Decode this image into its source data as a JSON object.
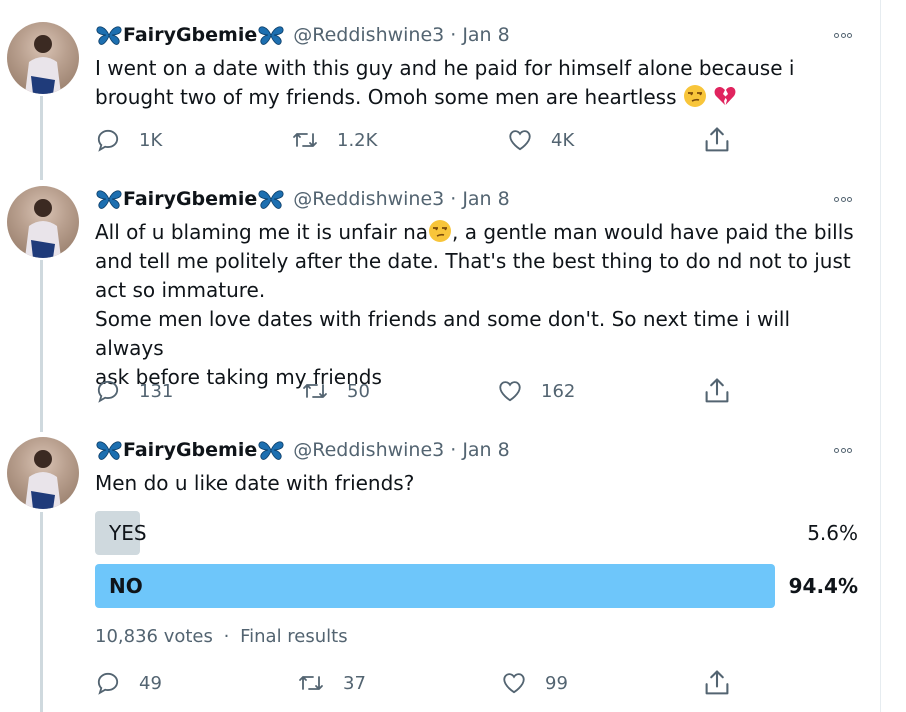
{
  "tweets": [
    {
      "name": "FairyGbemie",
      "handle": "@Reddishwine3",
      "separator": "·",
      "date": "Jan 8",
      "text_lines": [
        "I went on a date with this guy and he paid for himself alone because i",
        "brought two of my friends. Omoh some men are heartless"
      ],
      "emojis": [
        "unamused-face",
        "broken-heart"
      ],
      "replies": "1K",
      "retweets": "1.2K",
      "likes": "4K"
    },
    {
      "name": "FairyGbemie",
      "handle": "@Reddishwine3",
      "separator": "·",
      "date": "Jan 8",
      "text_lines": [
        "All of u blaming me it is unfair na",
        ", a gentle man would have paid the bills",
        "and tell me politely after the date. That's the best thing to do nd not to just",
        "act so immature.",
        "Some men love dates with friends and some don't. So next time i will always",
        "ask before taking my friends"
      ],
      "emojis": [
        "unamused-face"
      ],
      "replies": "131",
      "retweets": "50",
      "likes": "162"
    },
    {
      "name": "FairyGbemie",
      "handle": "@Reddishwine3",
      "separator": "·",
      "date": "Jan 8",
      "text_lines": [
        "Men do u like date with friends?"
      ],
      "replies": "49",
      "retweets": "37",
      "likes": "99"
    }
  ],
  "poll": {
    "options": [
      {
        "label": "YES",
        "percent_text": "5.6%",
        "percent": 5.6,
        "winner": false
      },
      {
        "label": "NO",
        "percent_text": "94.4%",
        "percent": 94.4,
        "winner": true
      }
    ],
    "votes": "10,836 votes",
    "separator": "·",
    "status": "Final results"
  },
  "colors": {
    "winner_bar": "#6ec6fa",
    "loser_bar": "#cfd9de",
    "secondary_text": "#536471",
    "butterfly": "#1d6fb0"
  },
  "icons": [
    "butterfly-icon",
    "more-icon",
    "reply-icon",
    "retweet-icon",
    "like-icon",
    "share-icon"
  ]
}
